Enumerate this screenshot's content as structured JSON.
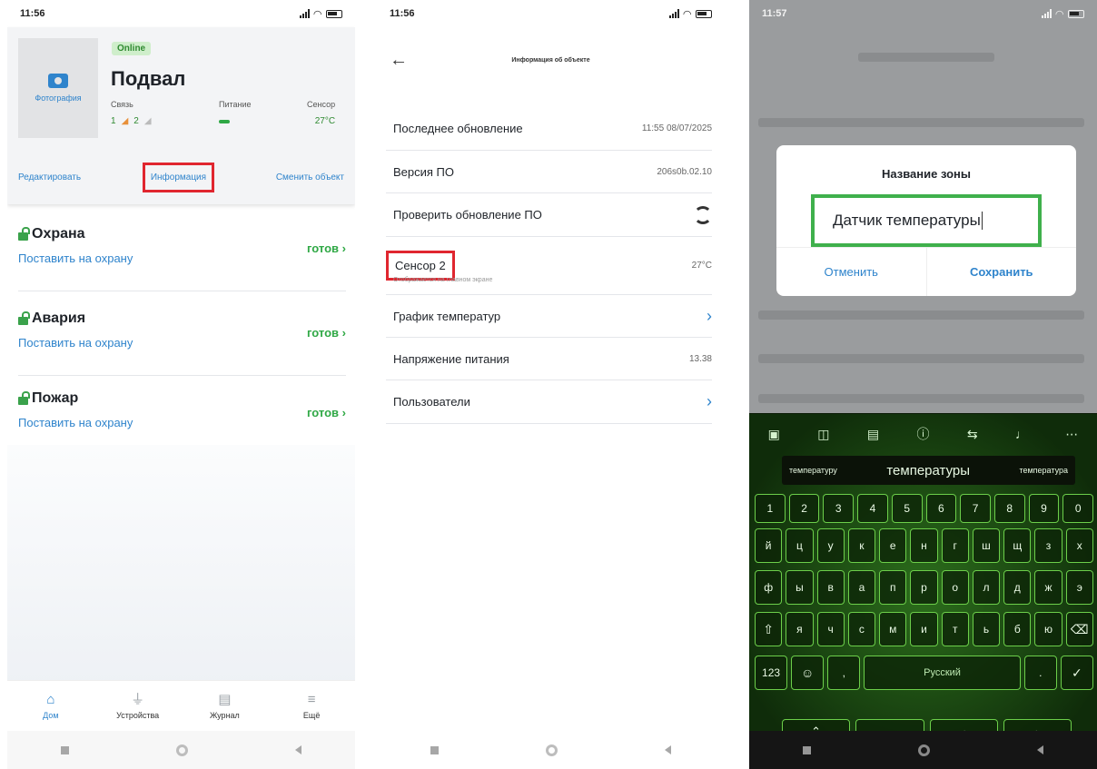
{
  "phone1": {
    "time": "11:56",
    "photo_label": "Фотография",
    "online": "Online",
    "object_name": "Подвал",
    "link": {
      "label": "Связь",
      "v1": "1",
      "v2": "2"
    },
    "power": {
      "label": "Питание"
    },
    "sensor": {
      "label": "Сенсор",
      "value": "27°C"
    },
    "actions": {
      "edit": "Редактировать",
      "info": "Информация",
      "change": "Сменить объект"
    },
    "zones": [
      {
        "name": "Охрана",
        "action": "Поставить на охрану",
        "status": "готов"
      },
      {
        "name": "Авария",
        "action": "Поставить на охрану",
        "status": "готов"
      },
      {
        "name": "Пожар",
        "action": "Поставить на охрану",
        "status": "готов"
      }
    ],
    "tabs": [
      "Дом",
      "Устройства",
      "Журнал",
      "Ещё"
    ]
  },
  "phone2": {
    "time": "11:56",
    "title": "Информация об объекте",
    "rows": {
      "last_update": {
        "label": "Последнее обновление",
        "value": "11:55 08/07/2025"
      },
      "firmware": {
        "label": "Версия ПО",
        "value": "206s0b.02.10"
      },
      "check_update": {
        "label": "Проверить обновление ПО"
      },
      "sensor": {
        "label": "Сенсор 2",
        "sub": "Отображается на главном экране",
        "value": "27°C"
      },
      "temp_chart": {
        "label": "График температур"
      },
      "voltage": {
        "label": "Напряжение питания",
        "value": "13.38"
      },
      "users": {
        "label": "Пользователи"
      }
    }
  },
  "phone3": {
    "time": "11:57",
    "dialog": {
      "title": "Название зоны",
      "value": "Датчик температуры",
      "cancel": "Отменить",
      "save": "Сохранить"
    },
    "keyboard": {
      "suggestions": [
        "температуру",
        "температуры",
        "температура"
      ],
      "digits": [
        "1",
        "2",
        "3",
        "4",
        "5",
        "6",
        "7",
        "8",
        "9",
        "0"
      ],
      "row1": [
        "й",
        "ц",
        "у",
        "к",
        "е",
        "н",
        "г",
        "ш",
        "щ",
        "з",
        "х"
      ],
      "row2": [
        "ф",
        "ы",
        "в",
        "а",
        "п",
        "р",
        "о",
        "л",
        "д",
        "ж",
        "э"
      ],
      "row3": [
        "я",
        "ч",
        "с",
        "м",
        "и",
        "т",
        "ь",
        "б",
        "ю"
      ],
      "num_key": "123",
      "space_label": "Русский"
    }
  }
}
